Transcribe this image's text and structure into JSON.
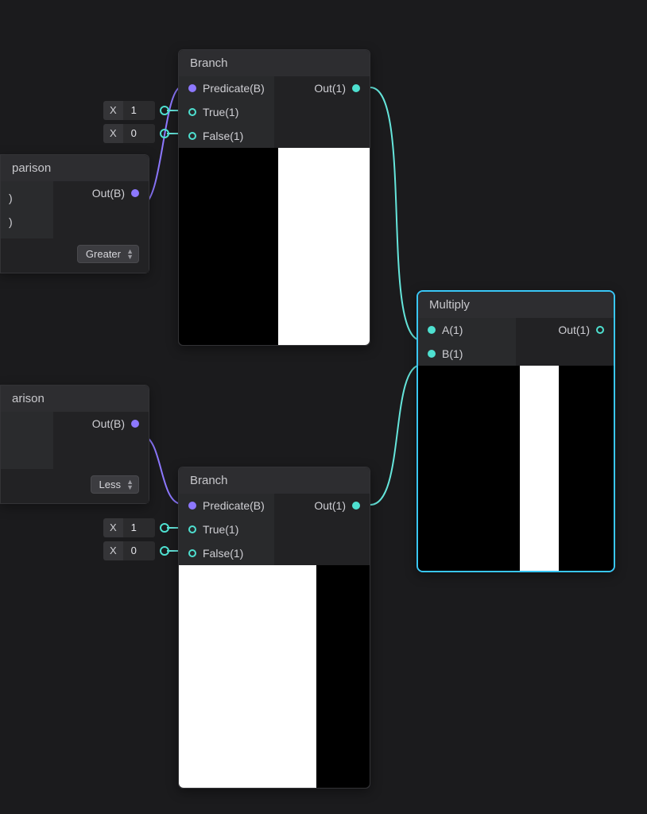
{
  "branch1": {
    "title": "Branch",
    "predicate": "Predicate(B)",
    "true": "True(1)",
    "false": "False(1)",
    "out": "Out(1)"
  },
  "branch2": {
    "title": "Branch",
    "predicate": "Predicate(B)",
    "true": "True(1)",
    "false": "False(1)",
    "out": "Out(1)"
  },
  "multiply": {
    "title": "Multiply",
    "a": "A(1)",
    "b": "B(1)",
    "out": "Out(1)"
  },
  "comp1": {
    "title_fragment": "parison",
    "in_a": ")",
    "in_b": ")",
    "out": "Out(B)",
    "mode": "Greater"
  },
  "comp2": {
    "title_fragment": "arison",
    "out": "Out(B)",
    "mode": "Less"
  },
  "num": {
    "x_label": "X",
    "v1": "1",
    "v0": "0"
  },
  "colors": {
    "wire_purple": "#8d78ff",
    "wire_teal": "#65e5db",
    "selection": "#39c7f7"
  }
}
